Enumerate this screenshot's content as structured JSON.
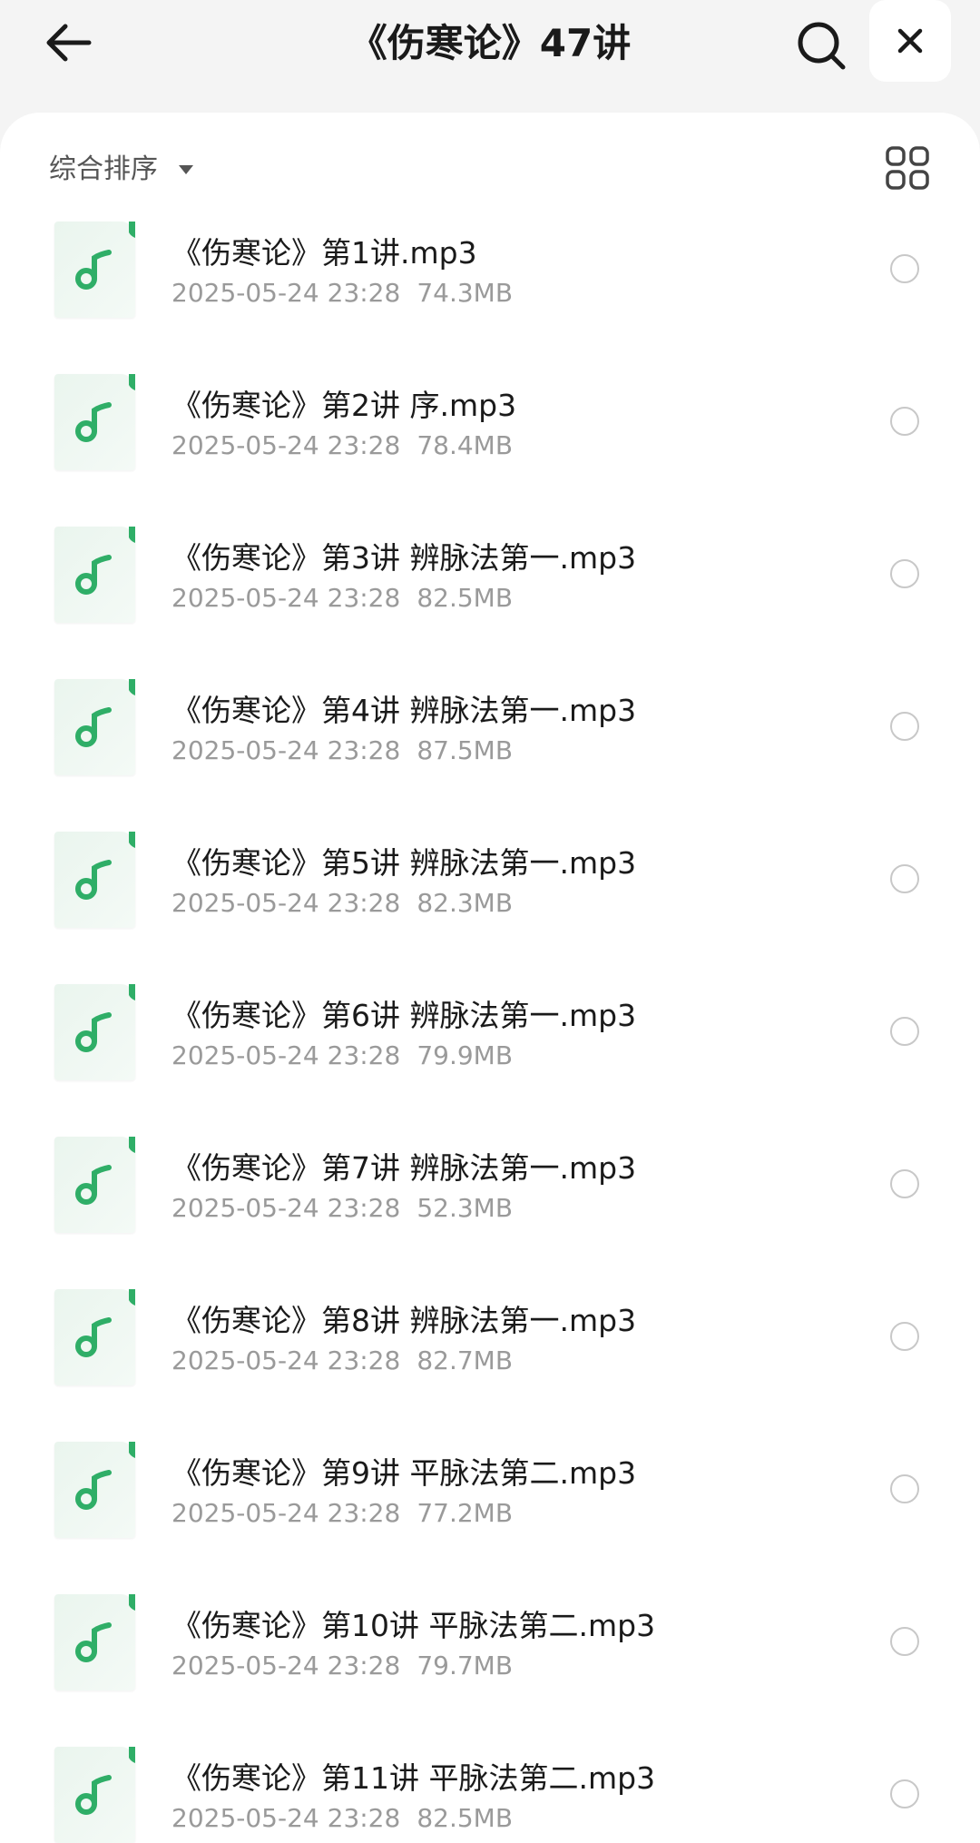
{
  "header": {
    "title": "《伤寒论》47讲",
    "back_icon": "arrow-left-icon",
    "search_icon": "search-icon",
    "close_icon": "close-icon"
  },
  "toolbar": {
    "sort_label": "综合排序",
    "sort_icon": "caret-down-icon",
    "view_icon": "grid-view-icon"
  },
  "colors": {
    "accent_green": "#2fae67",
    "thumb_bg": "#eaf5ee"
  },
  "files": [
    {
      "name": "《伤寒论》第1讲.mp3",
      "date": "2025-05-24 23:28",
      "size": "74.3MB"
    },
    {
      "name": "《伤寒论》第2讲 序.mp3",
      "date": "2025-05-24 23:28",
      "size": "78.4MB"
    },
    {
      "name": "《伤寒论》第3讲 辨脉法第一.mp3",
      "date": "2025-05-24 23:28",
      "size": "82.5MB"
    },
    {
      "name": "《伤寒论》第4讲 辨脉法第一.mp3",
      "date": "2025-05-24 23:28",
      "size": "87.5MB"
    },
    {
      "name": "《伤寒论》第5讲 辨脉法第一.mp3",
      "date": "2025-05-24 23:28",
      "size": "82.3MB"
    },
    {
      "name": "《伤寒论》第6讲 辨脉法第一.mp3",
      "date": "2025-05-24 23:28",
      "size": "79.9MB"
    },
    {
      "name": "《伤寒论》第7讲 辨脉法第一.mp3",
      "date": "2025-05-24 23:28",
      "size": "52.3MB"
    },
    {
      "name": "《伤寒论》第8讲 辨脉法第一.mp3",
      "date": "2025-05-24 23:28",
      "size": "82.7MB"
    },
    {
      "name": "《伤寒论》第9讲 平脉法第二.mp3",
      "date": "2025-05-24 23:28",
      "size": "77.2MB"
    },
    {
      "name": "《伤寒论》第10讲 平脉法第二.mp3",
      "date": "2025-05-24 23:28",
      "size": "79.7MB"
    },
    {
      "name": "《伤寒论》第11讲 平脉法第二.mp3",
      "date": "2025-05-24 23:28",
      "size": "82.5MB"
    }
  ]
}
